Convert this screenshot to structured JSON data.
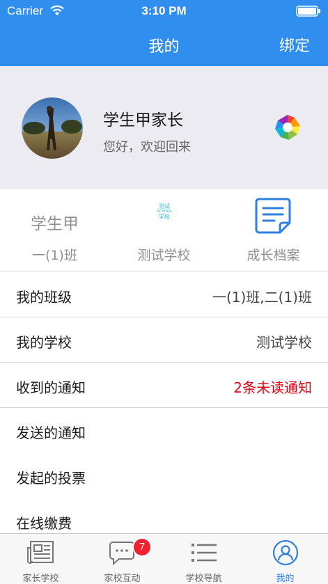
{
  "status_bar": {
    "carrier": "Carrier",
    "time": "3:10 PM"
  },
  "nav": {
    "title": "我的",
    "bind_label": "绑定"
  },
  "profile": {
    "name": "学生甲家长",
    "greeting": "您好，欢迎回来"
  },
  "quick": {
    "student_name": "学生甲",
    "class_label": "一(1)班",
    "school_logo_lines": [
      "测试",
      "SCHOOL",
      "学校"
    ],
    "school_label": "测试学校",
    "archive_label": "成长档案"
  },
  "list": [
    {
      "label": "我的班级",
      "value": "一(1)班,二(1)班"
    },
    {
      "label": "我的学校",
      "value": "测试学校"
    },
    {
      "label": "收到的通知",
      "value": "2条未读通知"
    },
    {
      "label": "发送的通知",
      "value": ""
    },
    {
      "label": "发起的投票",
      "value": ""
    },
    {
      "label": "在线缴费",
      "value": ""
    }
  ],
  "colors": {
    "brand": "#2f8eee",
    "alert": "#e60012",
    "tab_active": "#2f7fe0"
  },
  "tabs": [
    {
      "label": "家长学校",
      "icon": "newspaper-icon"
    },
    {
      "label": "家校互动",
      "icon": "chat-icon",
      "badge": "7"
    },
    {
      "label": "学校导航",
      "icon": "list-icon"
    },
    {
      "label": "我的",
      "icon": "user-icon",
      "active": true
    }
  ]
}
